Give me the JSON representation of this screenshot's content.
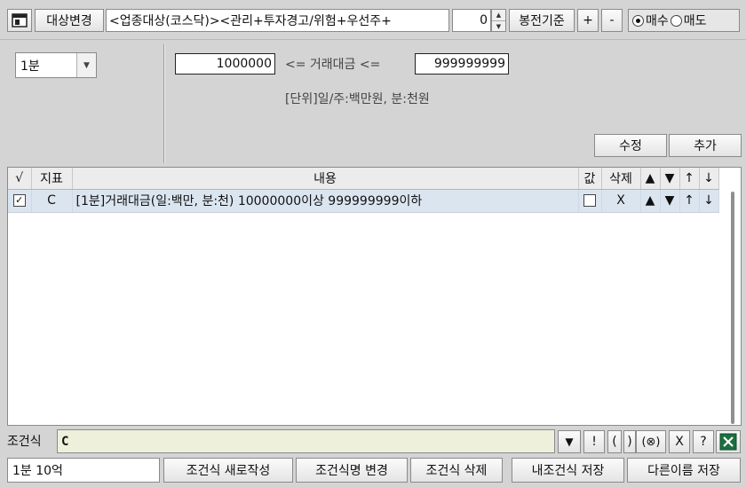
{
  "toolbar": {
    "target_button": "대상변경",
    "target_text": "<업종대상(코스닥)><관리+투자경고/위험+우선주+",
    "spin_value": "0",
    "candle_button": "봉전기준",
    "plus_button": "+",
    "minus_button": "-",
    "trade_type": [
      {
        "label": "매수",
        "selected": true
      },
      {
        "label": "매도",
        "selected": false
      }
    ]
  },
  "condition_panel": {
    "period_value": "1분",
    "min_value": "1000000",
    "range_label": "<= 거래대금 <=",
    "max_value": "999999999",
    "unit_note": "[단위]일/주:백만원, 분:천원",
    "edit_button": "수정",
    "add_button": "추가"
  },
  "grid": {
    "columns": [
      "√",
      "지표",
      "내용",
      "값",
      "삭제",
      "▲",
      "▼",
      "↑",
      "↓"
    ],
    "rows": [
      {
        "checked": true,
        "indicator": "C",
        "content": "[1분]거래대금(일:백만, 분:천) 10000000이상 999999999이하",
        "value_checked": false,
        "delete": "X",
        "up": "▲",
        "down": "▼",
        "top": "↑",
        "bottom": "↓"
      }
    ]
  },
  "formula": {
    "label": "조건식",
    "value": "C",
    "buttons": [
      "▼",
      "!",
      "(",
      ")",
      "(⊗)",
      "X",
      "?"
    ]
  },
  "bottom": {
    "name_value": "1분 10억",
    "buttons": [
      "조건식 새로작성",
      "조건식명 변경",
      "조건식 삭제",
      "내조건식 저장",
      "다른이름 저장"
    ]
  },
  "colors": {
    "background": "#d4d4d4",
    "selected_row": "#dbe5f0",
    "formula_field": "#eef0dc",
    "excel_green": "#1d6f42"
  }
}
